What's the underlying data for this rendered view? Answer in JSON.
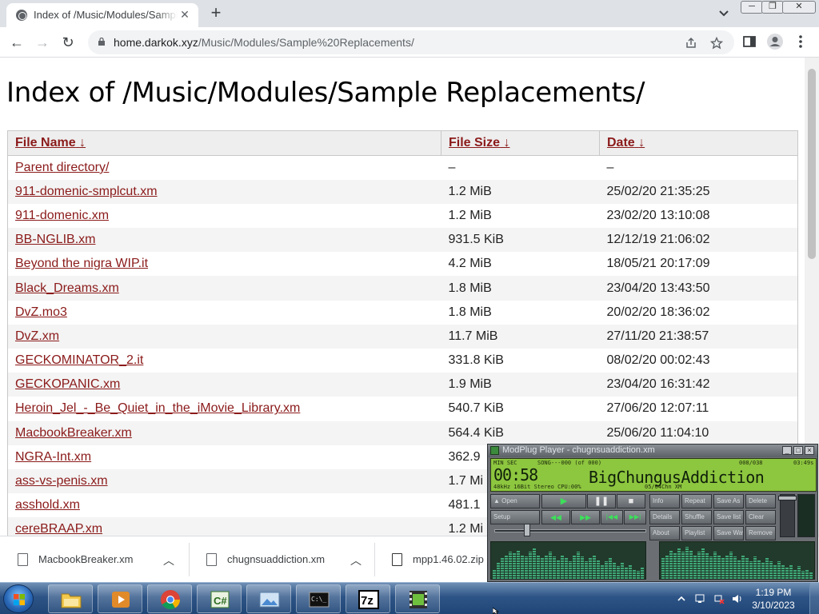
{
  "browser": {
    "tab_title": "Index of /Music/Modules/Sample Replacements/",
    "url_host": "home.darkok.xyz",
    "url_path": "/Music/Modules/Sample%20Replacements/"
  },
  "page": {
    "heading": "Index of /Music/Modules/Sample Replacements/",
    "columns": [
      {
        "label": "File Name",
        "sort": "↓"
      },
      {
        "label": "File Size",
        "sort": "↓"
      },
      {
        "label": "Date",
        "sort": "↓"
      }
    ],
    "rows": [
      {
        "name": "Parent directory/",
        "size": "–",
        "date": "–"
      },
      {
        "name": "911-domenic-smplcut.xm",
        "size": "1.2 MiB",
        "date": "25/02/20 21:35:25"
      },
      {
        "name": "911-domenic.xm",
        "size": "1.2 MiB",
        "date": "23/02/20 13:10:08"
      },
      {
        "name": "BB-NGLIB.xm",
        "size": "931.5 KiB",
        "date": "12/12/19 21:06:02"
      },
      {
        "name": "Beyond the nigra WIP.it",
        "size": "4.2 MiB",
        "date": "18/05/21 20:17:09"
      },
      {
        "name": "Black_Dreams.xm",
        "size": "1.8 MiB",
        "date": "23/04/20 13:43:50"
      },
      {
        "name": "DvZ.mo3",
        "size": "1.8 MiB",
        "date": "20/02/20 18:36:02"
      },
      {
        "name": "DvZ.xm",
        "size": "11.7 MiB",
        "date": "27/11/20 21:38:57"
      },
      {
        "name": "GECKOMINATOR_2.it",
        "size": "331.8 KiB",
        "date": "08/02/20 00:02:43"
      },
      {
        "name": "GECKOPANIC.xm",
        "size": "1.9 MiB",
        "date": "23/04/20 16:31:42"
      },
      {
        "name": "Heroin_Jel_-_Be_Quiet_in_the_iMovie_Library.xm",
        "size": "540.7 KiB",
        "date": "27/06/20 12:07:11"
      },
      {
        "name": "MacbookBreaker.xm",
        "size": "564.4 KiB",
        "date": "25/06/20 11:04:10"
      },
      {
        "name": "NGRA-Int.xm",
        "size": "362.9",
        "date": ""
      },
      {
        "name": "ass-vs-penis.xm",
        "size": "1.7 Mi",
        "date": ""
      },
      {
        "name": "asshold.xm",
        "size": "481.1",
        "date": ""
      },
      {
        "name": "cereBRAAP.xm",
        "size": "1.2 Mi",
        "date": ""
      }
    ]
  },
  "downloads": [
    {
      "filename": "MacbookBreaker.xm"
    },
    {
      "filename": "chugnsuaddiction.xm"
    },
    {
      "filename": "mpp1.46.02.zip"
    }
  ],
  "taskbar": {
    "time": "1:19 PM",
    "date": "3/10/2023",
    "apps": [
      "explorer-icon",
      "media-player-icon",
      "chrome-icon",
      "csharp-editor-icon",
      "photo-viewer-icon",
      "command-prompt-icon",
      "7zip-icon",
      "modplug-icon"
    ]
  },
  "modplug": {
    "window_title": "ModPlug Player - chugnsuaddiction.xm",
    "time_label": "MIN   SEC",
    "time": "00:58",
    "song_info": "SONG---000 (of 000)",
    "order_info": "008/038",
    "length_info": "03:49s",
    "format_info": "48kHz 16Bit Stereo CPU:00%",
    "channels_info": "05/04Chn XM",
    "song_title": "BigChungusAddiction",
    "buttons": {
      "open": "Open",
      "setup": "Setup",
      "info": "Info",
      "repeat": "Repeat",
      "save_as": "Save As",
      "delete": "Delete",
      "details": "Details",
      "shuffle": "Shuffle",
      "save_list": "Save list",
      "clear": "Clear",
      "about": "About",
      "playlist": "Playlist",
      "save_wav": "Save Wav",
      "remove": "Remove"
    },
    "spectrum_left": [
      12,
      20,
      26,
      30,
      34,
      32,
      36,
      30,
      28,
      34,
      38,
      30,
      26,
      30,
      34,
      28,
      24,
      30,
      26,
      22,
      30,
      34,
      28,
      22,
      26,
      30,
      24,
      18,
      22,
      26,
      20,
      16,
      20,
      14,
      18,
      12,
      10,
      14
    ],
    "spectrum_right": [
      26,
      30,
      36,
      32,
      38,
      34,
      40,
      36,
      30,
      34,
      38,
      32,
      28,
      34,
      30,
      26,
      30,
      34,
      28,
      24,
      30,
      26,
      22,
      28,
      24,
      20,
      26,
      22,
      18,
      22,
      18,
      14,
      18,
      12,
      16,
      10,
      12,
      8
    ]
  }
}
